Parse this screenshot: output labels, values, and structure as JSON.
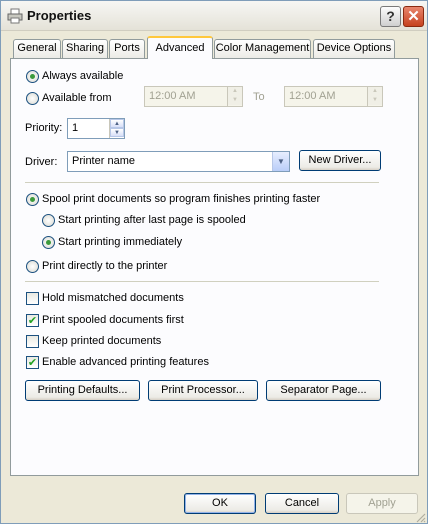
{
  "window": {
    "title": "Properties"
  },
  "titlebar": {
    "help_label": "?",
    "close_label": "✕"
  },
  "tabs": [
    {
      "label": "General"
    },
    {
      "label": "Sharing"
    },
    {
      "label": "Ports"
    },
    {
      "label": "Advanced",
      "active": true
    },
    {
      "label": "Color Management"
    },
    {
      "label": "Device Options"
    }
  ],
  "availability": {
    "always_label": "Always available",
    "from_label": "Available from",
    "from_time": "12:00 AM",
    "to_label": "To",
    "to_time": "12:00 AM",
    "selected": "always"
  },
  "priority": {
    "label": "Priority:",
    "value": "1"
  },
  "driver": {
    "label": "Driver:",
    "value": "Printer name",
    "new_driver_label": "New Driver..."
  },
  "spool": {
    "spool_label": "Spool print documents so program finishes printing faster",
    "after_last_page_label": "Start printing after last page is spooled",
    "immediately_label": "Start printing immediately",
    "direct_label": "Print directly to the printer"
  },
  "options": [
    {
      "label": "Hold mismatched documents",
      "checked": false
    },
    {
      "label": "Print spooled documents first",
      "checked": true
    },
    {
      "label": "Keep printed documents",
      "checked": false
    },
    {
      "label": "Enable advanced printing features",
      "checked": true
    }
  ],
  "bottom_buttons": {
    "printing_defaults": "Printing Defaults...",
    "print_processor": "Print Processor...",
    "separator_page": "Separator Page..."
  },
  "dialog_buttons": {
    "ok": "OK",
    "cancel": "Cancel",
    "apply": "Apply"
  }
}
